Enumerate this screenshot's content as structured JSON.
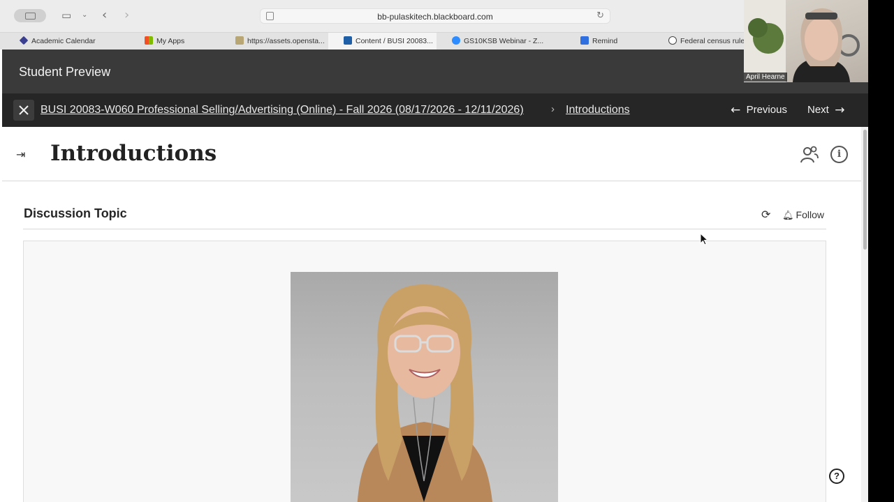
{
  "browser": {
    "url": "bb-pulaskitech.blackboard.com"
  },
  "bookmarks": [
    {
      "label": "Academic Calendar",
      "icon": "diamond-icon",
      "color": "#3b3f8f"
    },
    {
      "label": "My Apps",
      "icon": "microsoft-icon",
      "color": "#f25022"
    },
    {
      "label": "https://assets.opensta...",
      "icon": "stack-icon",
      "color": "#7a6a3a"
    },
    {
      "label": "Content / BUSI 20083...",
      "icon": "blackboard-icon",
      "color": "#1f5fa8"
    },
    {
      "label": "GS10KSB Webinar - Z...",
      "icon": "zoom-icon",
      "color": "#2d8cff"
    },
    {
      "label": "Remind",
      "icon": "remind-icon",
      "color": "#2f6fe0"
    },
    {
      "label": "Federal census rule",
      "icon": "chatgpt-icon",
      "color": "#444444"
    }
  ],
  "preview": {
    "title": "Student Preview"
  },
  "breadcrumb": {
    "course": "BUSI 20083-W060 Professional Selling/Advertising (Online) - Fall 2026 (08/17/2026 - 12/11/2026)",
    "separator": "›",
    "current": "Introductions",
    "previous_label": "Previous",
    "next_label": "Next"
  },
  "page": {
    "title": "Introductions"
  },
  "discussion": {
    "heading": "Discussion Topic",
    "follow_label": "Follow"
  },
  "webcam": {
    "name": "April Hearne"
  },
  "help": {
    "glyph": "?"
  }
}
